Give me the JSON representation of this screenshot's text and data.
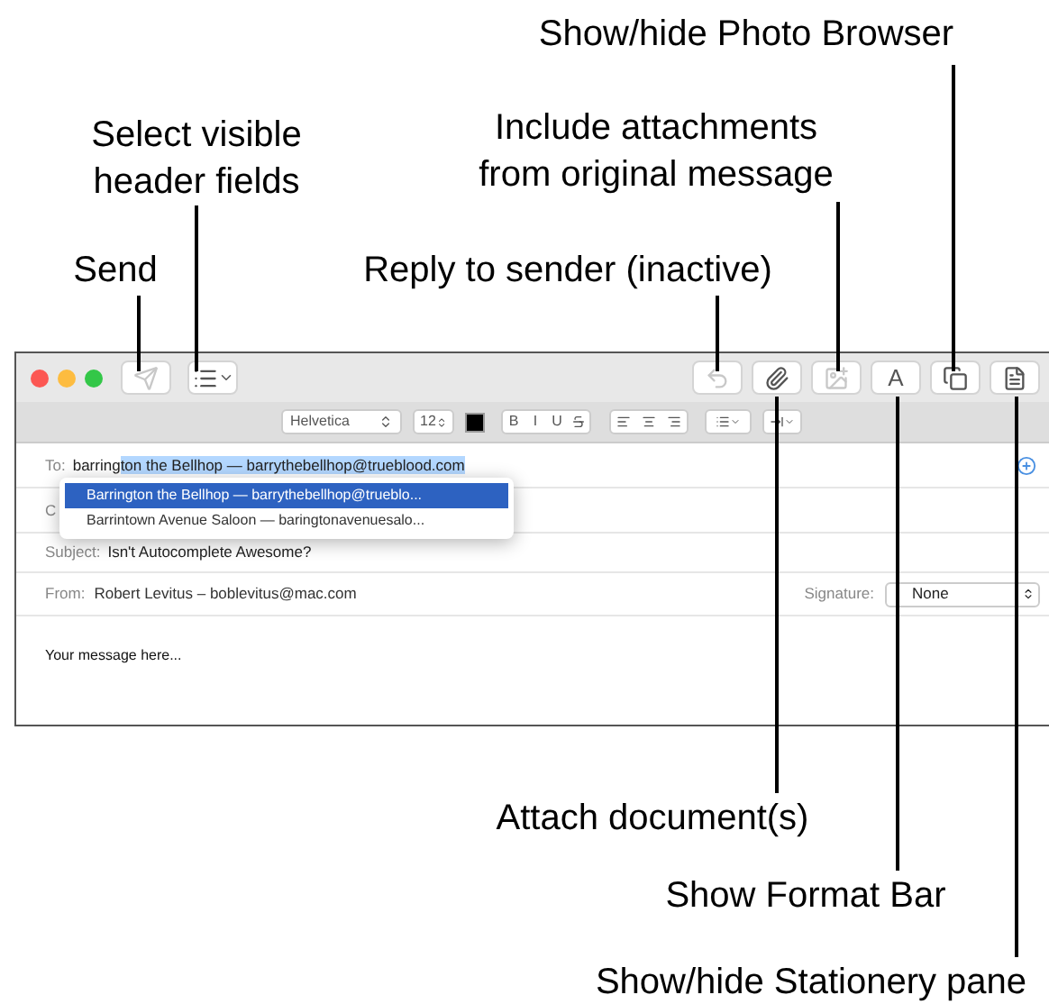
{
  "callouts": [
    {
      "text": "Show/hide Photo Browser"
    },
    {
      "text": "Select visible header fields"
    },
    {
      "text": "Include attachments from original message"
    },
    {
      "text": "Send"
    },
    {
      "text": "Reply to sender (inactive)"
    },
    {
      "text": "Attach document(s)"
    },
    {
      "text": "Show Format Bar"
    },
    {
      "text": "Show/hide Stationery pane"
    }
  ],
  "toolbar": {
    "left": [
      {
        "kind": "send",
        "disabled": true
      },
      {
        "kind": "header-fields",
        "disabled": false
      }
    ],
    "right": [
      {
        "kind": "reply",
        "disabled": true
      },
      {
        "kind": "attach",
        "disabled": false
      },
      {
        "kind": "include",
        "disabled": true
      },
      {
        "kind": "format",
        "label": "A",
        "disabled": false
      },
      {
        "kind": "photo",
        "disabled": false
      },
      {
        "kind": "stationery",
        "disabled": false
      }
    ]
  },
  "format_bar": {
    "font": "Helvetica",
    "size": "12",
    "style_buttons": [
      {
        "kind": "text",
        "label": "B"
      },
      {
        "kind": "text",
        "label": "I"
      },
      {
        "kind": "text",
        "label": "U"
      },
      {
        "kind": "strike"
      }
    ]
  },
  "to": {
    "label": "To:",
    "typed": "barring",
    "completion": "ton the Bellhop — barrythebellhop@trueblood.com"
  },
  "suggestions": [
    {
      "text": "Barrington the Bellhop — barrythebellhop@trueblo...",
      "selected": true
    },
    {
      "text": "Barrintown Avenue Saloon — baringtonavenuesalo...",
      "selected": false
    }
  ],
  "cc": {
    "label": "C"
  },
  "subject": {
    "label": "Subject:",
    "value": "Isn't Autocomplete Awesome?"
  },
  "from": {
    "label": "From:",
    "value": "Robert Levitus – boblevitus@mac.com"
  },
  "signature": {
    "label": "Signature:",
    "value": "None"
  },
  "body": "Your message here..."
}
